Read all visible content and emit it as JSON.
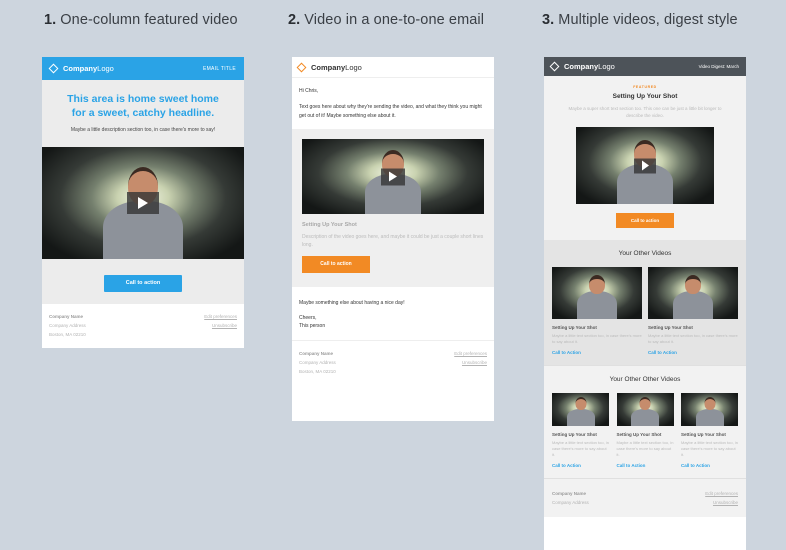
{
  "columns": [
    {
      "number": "1.",
      "title": "One-column featured video"
    },
    {
      "number": "2.",
      "title": "Video in a one-to-one email"
    },
    {
      "number": "3.",
      "title": "Multiple videos, digest style"
    }
  ],
  "logo": {
    "bold": "Company",
    "rest": "Logo"
  },
  "footer": {
    "name": "Company Name",
    "address": "Company Address",
    "city": "Boston, MA 02210",
    "edit": "Edit preferences",
    "unsubscribe": "Unsubscribe"
  },
  "email1": {
    "header_label": "EMAIL TITLE",
    "headline": "This area is home sweet home for a sweet, catchy headline.",
    "description": "Maybe a little description section too, in case there's more to say!",
    "cta": "Call to action"
  },
  "email2": {
    "greeting": "Hi Chris,",
    "intro": "Text goes here about why they're sending the video, and what they think you might get out of it! Maybe something else about it.",
    "video_title": "Setting Up Your Shot",
    "video_desc": "Description of the video goes here, and maybe it could be just a couple short lines long.",
    "cta": "Call to action",
    "closing": "Maybe something else about having a nice day!",
    "signoff": "Cheers,",
    "signature": "This person"
  },
  "email3": {
    "header_right": "Video Digest: March",
    "featured_tag": "FEATURED",
    "featured_title": "Setting Up Your Shot",
    "featured_desc": "Maybe a super short text section too. This one can be just a little bit longer to describe the video.",
    "featured_cta": "Call to action",
    "section1_title": "Your Other Videos",
    "section2_title": "Your Other Other Videos",
    "item_title": "Setting Up Your Shot",
    "item_desc": "Maybe a little text section too, in case there's more to say about it.",
    "item_cta": "Call to Action"
  },
  "colors": {
    "blue": "#2aa3e6",
    "orange": "#f28a24",
    "background": "#cdd5de",
    "digest_header": "#4d5359"
  },
  "icons": [
    "logo-diamond-icon",
    "play-icon"
  ]
}
